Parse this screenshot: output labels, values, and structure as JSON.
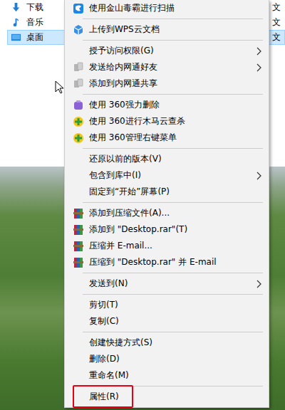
{
  "explorer": {
    "sidebar": {
      "items": [
        {
          "label": "下载",
          "selected": false,
          "type_cell": "文"
        },
        {
          "label": "音乐",
          "selected": false,
          "type_cell": "文"
        },
        {
          "label": "桌面",
          "selected": true,
          "type_cell": "文"
        }
      ]
    }
  },
  "context_menu": {
    "items": [
      {
        "kind": "item",
        "label": "使用金山毒霸进行扫描",
        "submenu": false,
        "highlighted": false
      },
      {
        "kind": "separator"
      },
      {
        "kind": "item",
        "label": "上传到WPS云文档",
        "submenu": false,
        "highlighted": false
      },
      {
        "kind": "separator"
      },
      {
        "kind": "item",
        "label": "授予访问权限(G)",
        "submenu": true,
        "highlighted": false
      },
      {
        "kind": "item",
        "label": "发送给内网通好友",
        "submenu": true,
        "highlighted": false
      },
      {
        "kind": "item",
        "label": "添加到内网通共享",
        "submenu": false,
        "highlighted": false
      },
      {
        "kind": "separator"
      },
      {
        "kind": "item",
        "label": "使用 360强力删除",
        "submenu": false,
        "highlighted": false
      },
      {
        "kind": "item",
        "label": "使用 360进行木马云查杀",
        "submenu": false,
        "highlighted": false
      },
      {
        "kind": "item",
        "label": "使用 360管理右键菜单",
        "submenu": false,
        "highlighted": false
      },
      {
        "kind": "separator"
      },
      {
        "kind": "item",
        "label": "还原以前的版本(V)",
        "submenu": false,
        "highlighted": false
      },
      {
        "kind": "item",
        "label": "包含到库中(I)",
        "submenu": true,
        "highlighted": false
      },
      {
        "kind": "item",
        "label": "固定到“开始”屏幕(P)",
        "submenu": false,
        "highlighted": false
      },
      {
        "kind": "separator"
      },
      {
        "kind": "item",
        "label": "添加到压缩文件(A)...",
        "submenu": false,
        "highlighted": false
      },
      {
        "kind": "item",
        "label": "添加到 \"Desktop.rar\"(T)",
        "submenu": false,
        "highlighted": false
      },
      {
        "kind": "item",
        "label": "压缩并 E-mail...",
        "submenu": false,
        "highlighted": false
      },
      {
        "kind": "item",
        "label": "压缩到 \"Desktop.rar\" 并 E-mail",
        "submenu": false,
        "highlighted": false
      },
      {
        "kind": "separator"
      },
      {
        "kind": "item",
        "label": "发送到(N)",
        "submenu": true,
        "highlighted": false
      },
      {
        "kind": "separator"
      },
      {
        "kind": "item",
        "label": "剪切(T)",
        "submenu": false,
        "highlighted": false
      },
      {
        "kind": "item",
        "label": "复制(C)",
        "submenu": false,
        "highlighted": false
      },
      {
        "kind": "separator"
      },
      {
        "kind": "item",
        "label": "创建快捷方式(S)",
        "submenu": false,
        "highlighted": false
      },
      {
        "kind": "item",
        "label": "删除(D)",
        "submenu": false,
        "highlighted": false
      },
      {
        "kind": "item",
        "label": "重命名(M)",
        "submenu": false,
        "highlighted": false
      },
      {
        "kind": "separator"
      },
      {
        "kind": "item",
        "label": "属性(R)",
        "submenu": false,
        "highlighted": true
      }
    ]
  }
}
